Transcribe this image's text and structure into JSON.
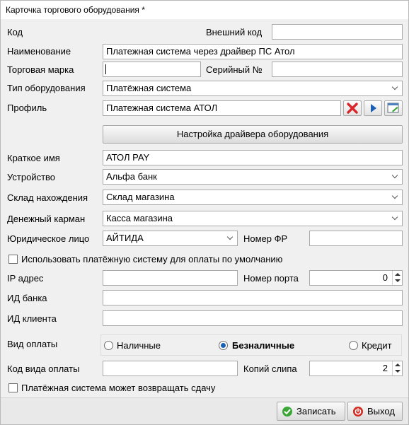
{
  "window": {
    "title": "Карточка торгового оборудования *"
  },
  "labels": {
    "code": "Код",
    "external_code": "Внешний код",
    "name": "Наименование",
    "brand": "Торговая марка",
    "serial": "Серийный №",
    "equipment_type": "Тип оборудования",
    "profile": "Профиль",
    "short_name": "Краткое имя",
    "device": "Устройство",
    "warehouse": "Склад нахождения",
    "money_pocket": "Денежный карман",
    "legal_entity": "Юридическое лицо",
    "fr_number": "Номер ФР",
    "default_payment": "Использовать платёжную систему для оплаты по умолчанию",
    "ip_address": "IP адрес",
    "port_number": "Номер порта",
    "bank_id": "ИД банка",
    "client_id": "ИД клиента",
    "payment_kind": "Вид оплаты",
    "payment_code": "Код вида оплаты",
    "slip_copies": "Копий слипа",
    "can_return_change": "Платёжная система может возвращать сдачу"
  },
  "values": {
    "code": "",
    "external_code": "",
    "name": "Платежная система через драйвер ПС Атол",
    "brand": "",
    "serial": "",
    "equipment_type": "Платёжная система",
    "profile": "Платежная система АТОЛ",
    "short_name": "АТОЛ PAY",
    "device": "Альфа банк",
    "warehouse": "Склад магазина",
    "money_pocket": "Касса магазина",
    "legal_entity": "АЙТИДА",
    "fr_number": "",
    "ip_address": "",
    "port_number": "0",
    "bank_id": "",
    "client_id": "",
    "payment_code": "",
    "slip_copies": "2"
  },
  "driver_button": "Настройка драйвера оборудования",
  "payment_options": {
    "cash": "Наличные",
    "cashless": "Безналичные",
    "credit": "Кредит",
    "selected": "cashless"
  },
  "checkboxes": {
    "default_payment": false,
    "can_return_change": false
  },
  "buttons": {
    "save": "Записать",
    "exit": "Выход"
  },
  "colors": {
    "clear_icon": "#d9262a",
    "play_icon": "#1a5fb4",
    "save_icon": "#3aa635",
    "exit_icon": "#d22b22"
  }
}
